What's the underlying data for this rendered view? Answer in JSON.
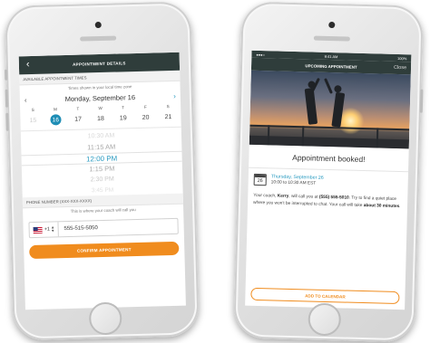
{
  "left_phone": {
    "header_title": "APPOINTMENT DETAILS",
    "section_times": "AVAILABLE APPOINTMENT TIMES",
    "timezone_hint": "Times shown in your local time zone",
    "month_label": "Monday, September 16",
    "weekdays": [
      "S",
      "M",
      "T",
      "W",
      "T",
      "F",
      "S"
    ],
    "dates": [
      "15",
      "16",
      "17",
      "18",
      "19",
      "20",
      "21"
    ],
    "selected_date": "16",
    "times": [
      "10:30 AM",
      "11:15 AM",
      "12:00 PM",
      "1:15 PM",
      "2:30 PM",
      "3:45 PM"
    ],
    "selected_time": "12:00 PM",
    "section_phone": "PHONE NUMBER (XXX-XXX-XXXX)",
    "phone_hint": "This is where your coach will call you",
    "country_code": "+1",
    "phone_value": "555-515-5050",
    "confirm_label": "CONFIRM APPOINTMENT"
  },
  "right_phone": {
    "status_time": "9:41 AM",
    "status_battery": "100%",
    "header_title": "UPCOMING APPOINTMENT",
    "close_label": "Close",
    "booked_title": "Appointment booked!",
    "calendar_icon_day": "26",
    "date_label": "Thursday, September 26",
    "time_label": "10:00 to 10:30 AM EST",
    "message_part1": "Your coach, ",
    "coach_name": "Kerry",
    "message_part2": ", will call you at ",
    "coach_phone": "(555) 555-5010",
    "message_part3": ". Try to find a quiet place where you won't be interrupted to chat. Your call will take ",
    "duration": "about 30 minutes",
    "message_part4": ".",
    "add_calendar_label": "ADD TO CALENDAR"
  },
  "colors": {
    "header": "#2f3d3b",
    "accent_blue": "#2a9bc1",
    "accent_orange": "#f08c1e"
  }
}
